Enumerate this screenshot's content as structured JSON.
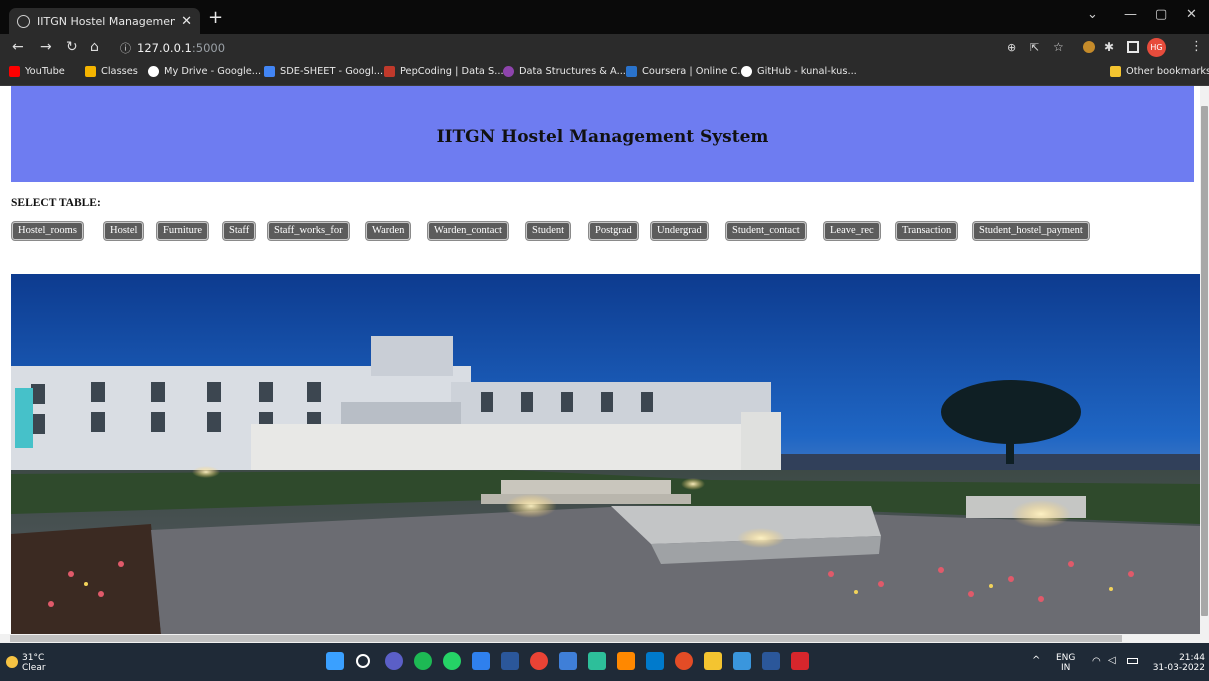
{
  "browser": {
    "tab_title": "IITGN Hostel Management Syste",
    "tab_close": "✕",
    "new_tab": "+",
    "url_host": "127.0.0.1",
    "url_port": ":5000",
    "bookmarks": [
      {
        "label": "YouTube",
        "color": "#ff0000"
      },
      {
        "label": "Classes",
        "color": "#f4b400"
      },
      {
        "label": "My Drive - Google...",
        "color": "#34a853"
      },
      {
        "label": "SDE-SHEET - Googl...",
        "color": "#4285f4"
      },
      {
        "label": "PepCoding | Data S...",
        "color": "#c0392b"
      },
      {
        "label": "Data Structures & A...",
        "color": "#8e44ad"
      },
      {
        "label": "Coursera | Online C...",
        "color": "#2a73cc"
      },
      {
        "label": "GitHub - kunal-kus...",
        "color": "#ffffff"
      }
    ],
    "other_bookmarks": "Other bookmarks",
    "profile_initials": "HG"
  },
  "page": {
    "title": "IITGN Hostel Management System",
    "select_label": "SELECT TABLE:",
    "banner_color": "#6e7cf1",
    "table_buttons": [
      "Hostel_rooms",
      "Hostel",
      "Furniture",
      "Staff",
      "Staff_works_for",
      "Warden",
      "Warden_contact",
      "Student",
      "Postgrad",
      "Undergrad",
      "Student_contact",
      "Leave_rec",
      "Transaction",
      "Student_hostel_payment"
    ]
  },
  "taskbar": {
    "temperature": "31°C",
    "condition": "Clear",
    "lang": "ENG",
    "region": "IN",
    "time": "21:44",
    "date": "31-03-2022"
  }
}
